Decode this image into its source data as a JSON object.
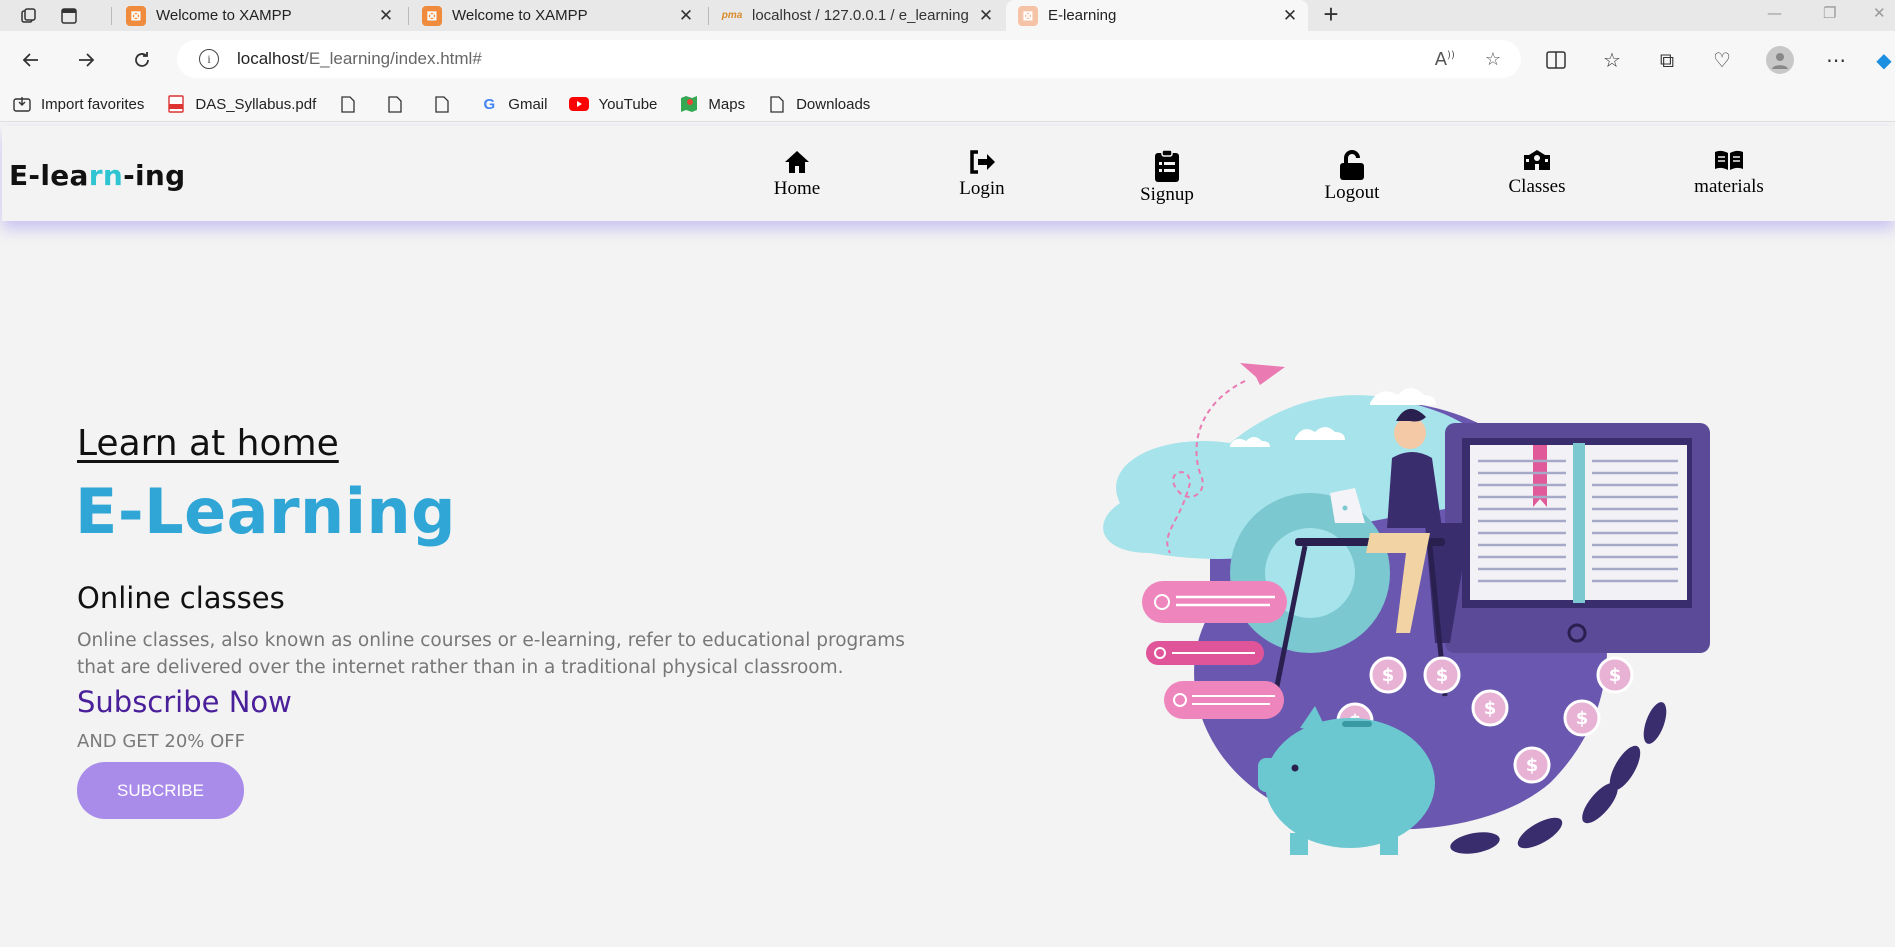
{
  "browser": {
    "tabs": [
      {
        "title": "Welcome to XAMPP",
        "active": false
      },
      {
        "title": "Welcome to XAMPP",
        "active": false
      },
      {
        "title": "localhost / 127.0.0.1 / e_learning",
        "active": false
      },
      {
        "title": "E-learning",
        "active": true
      }
    ],
    "address": {
      "host": "localhost",
      "path": "/E_learning/index.html#"
    },
    "bookmarks": [
      {
        "label": "Import favorites",
        "icon": "import-icon"
      },
      {
        "label": "DAS_Syllabus.pdf",
        "icon": "pdf-icon"
      },
      {
        "label": "",
        "icon": "file-icon"
      },
      {
        "label": "",
        "icon": "file-icon"
      },
      {
        "label": "",
        "icon": "file-icon"
      },
      {
        "label": "Gmail",
        "icon": "google-icon"
      },
      {
        "label": "YouTube",
        "icon": "youtube-icon"
      },
      {
        "label": "Maps",
        "icon": "maps-icon"
      },
      {
        "label": "Downloads",
        "icon": "file-icon"
      }
    ]
  },
  "site": {
    "logo": {
      "part1": "E-lea",
      "accent": "rn",
      "part2": "-ing"
    },
    "menu": [
      {
        "label": "Home",
        "icon": "home-icon"
      },
      {
        "label": "Login",
        "icon": "sign-in-icon"
      },
      {
        "label": "Signup",
        "icon": "clipboard-icon"
      },
      {
        "label": "Logout",
        "icon": "unlock-icon"
      },
      {
        "label": "Classes",
        "icon": "school-icon"
      },
      {
        "label": "materials",
        "icon": "book-icon"
      }
    ],
    "hero": {
      "subtitle": "Learn at home",
      "title": "E-Learning",
      "section_title": "Online classes",
      "description": "Online classes, also known as online courses or e-learning, refer to educational programs that are delivered over the internet rather than in a traditional physical classroom.",
      "subscribe_title": "Subscribe Now",
      "offer": "AND GET 20% OFF",
      "button": "SUBCRIBE"
    },
    "colors": {
      "accent": "#2fa6d6",
      "logo_accent": "#2ec4d2",
      "subscribe": "#4a1f9a",
      "button": "#a98bea",
      "nav_shadow": "#968cf0"
    }
  }
}
